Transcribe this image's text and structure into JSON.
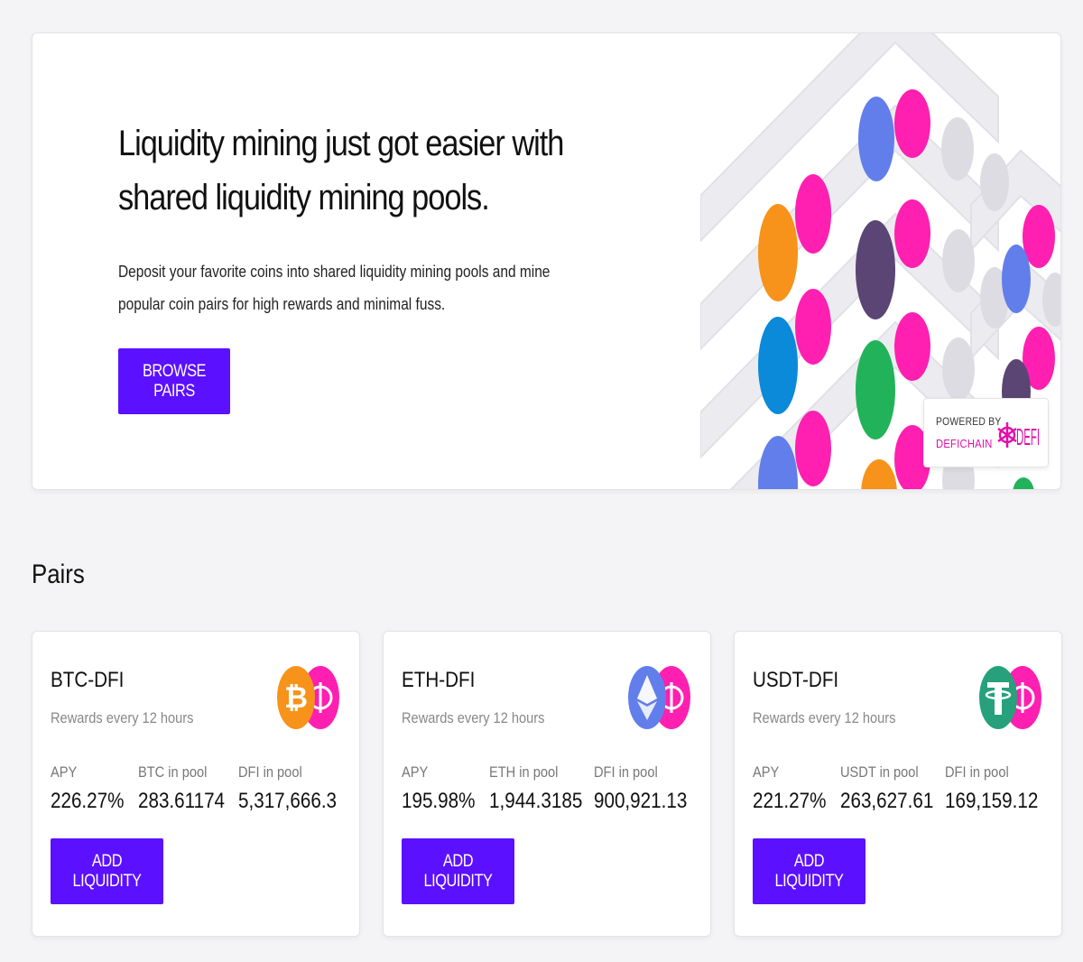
{
  "hero": {
    "title_line1": "Liquidity mining just got easier with",
    "title_line2": "shared liquidity mining pools.",
    "desc_line1": "Deposit your favorite coins into shared liquidity mining pools and mine",
    "desc_line2": "popular coin pairs for high rewards and minimal fuss.",
    "browse_label": "BROWSE PAIRS",
    "powered_by": "POWERED BY",
    "powered_brand": "DEFICHAIN",
    "powered_logo_text": "DEFI"
  },
  "pairs_title": "Pairs",
  "colors": {
    "accent": "#5b10ff",
    "defi_pink": "#ff1fb0",
    "btc_orange": "#f7931a",
    "eth_blue": "#627eea",
    "usdt_green": "#26a17b"
  },
  "pairs": [
    {
      "name": "BTC-DFI",
      "rewards": "Rewards every 12 hours",
      "apy_label": "APY",
      "apy": "226.27%",
      "coin_label": "BTC in pool",
      "coin_value": "283.61174",
      "dfi_label": "DFI in pool",
      "dfi_value": "5,317,666.3",
      "button": "ADD LIQUIDITY",
      "icon": "bitcoin-icon"
    },
    {
      "name": "ETH-DFI",
      "rewards": "Rewards every 12 hours",
      "apy_label": "APY",
      "apy": "195.98%",
      "coin_label": "ETH in pool",
      "coin_value": "1,944.3185",
      "dfi_label": "DFI in pool",
      "dfi_value": "900,921.13",
      "button": "ADD LIQUIDITY",
      "icon": "ethereum-icon"
    },
    {
      "name": "USDT-DFI",
      "rewards": "Rewards every 12 hours",
      "apy_label": "APY",
      "apy": "221.27%",
      "coin_label": "USDT in pool",
      "coin_value": "263,627.61",
      "dfi_label": "DFI in pool",
      "dfi_value": "169,159.12",
      "button": "ADD LIQUIDITY",
      "icon": "tether-icon"
    }
  ]
}
